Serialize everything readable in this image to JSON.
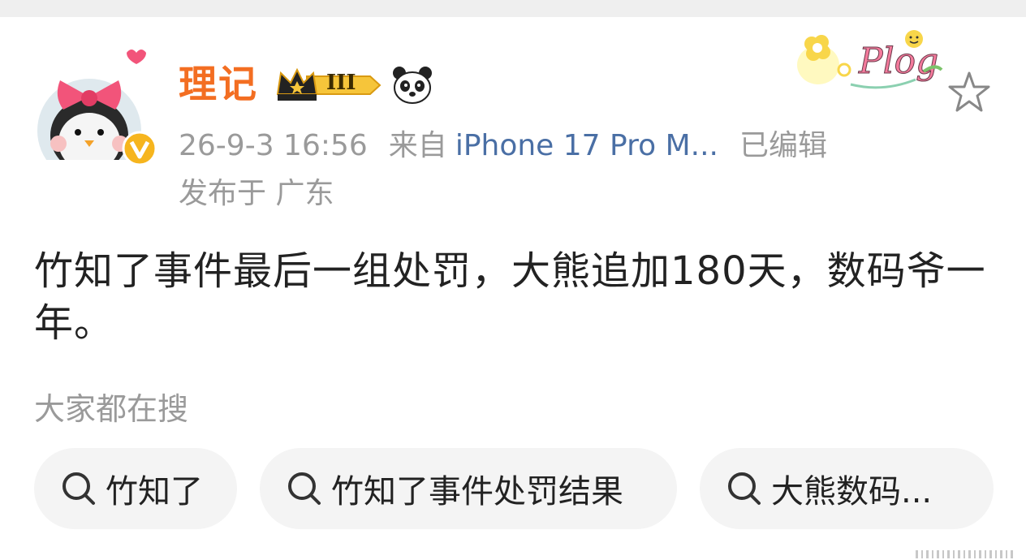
{
  "post": {
    "username": "理记",
    "level_badge": "III",
    "timestamp": "26-9-3 16:56",
    "source_prefix": "来自",
    "device": "iPhone 17 Pro M...",
    "edited": "已编辑",
    "location": "发布于 广东",
    "text": "竹知了事件最后一组处罚，大熊追加180天，数码爷一年。",
    "plog_label": "Plog"
  },
  "search": {
    "title": "大家都在搜",
    "chips": [
      "竹知了",
      "竹知了事件处罚结果",
      "大熊数码..."
    ]
  },
  "icons": {
    "search": "search-icon",
    "star": "star-icon",
    "crown": "crown-icon",
    "panda": "panda-icon",
    "verified": "verified-v-icon",
    "bow": "bow-icon"
  },
  "colors": {
    "username": "#f36e22",
    "device_link": "#4a6fa5",
    "meta": "#9a9a9a",
    "chip_bg": "#f4f4f4",
    "text": "#222222"
  }
}
